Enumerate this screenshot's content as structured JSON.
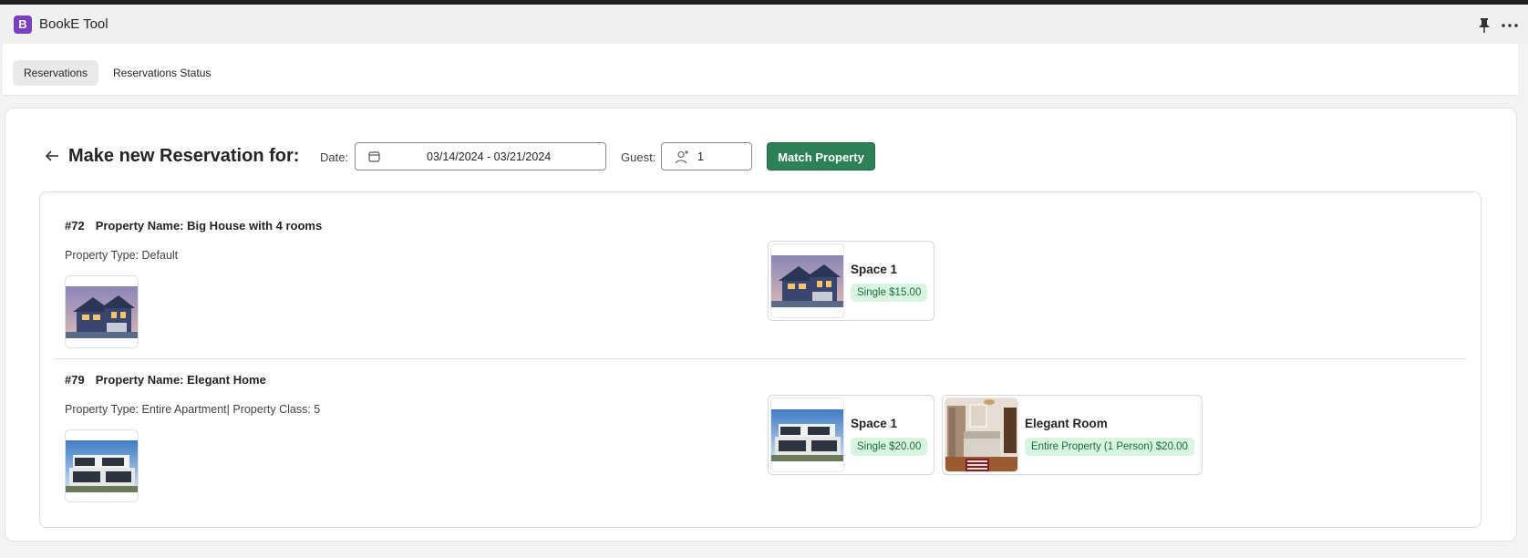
{
  "app": {
    "logo_letter": "B",
    "title": "BookE Tool"
  },
  "header_icons": [
    "pin-icon",
    "more-icon"
  ],
  "tabs": [
    {
      "label": "Reservations",
      "active": true
    },
    {
      "label": "Reservations Status",
      "active": false
    }
  ],
  "form": {
    "heading": "Make new Reservation for:",
    "date_label": "Date:",
    "date_value": "03/14/2024 - 03/21/2024",
    "guest_label": "Guest:",
    "guest_value": "1",
    "match_button": "Match Property"
  },
  "properties": [
    {
      "number": "#72",
      "name": "Property Name: Big House with 4 rooms",
      "type": "Property Type: Default",
      "spaces": [
        {
          "name": "Space 1",
          "price": "Single $15.00"
        }
      ]
    },
    {
      "number": "#79",
      "name": "Property Name: Elegant Home",
      "type": "Property Type: Entire Apartment| Property Class: 5",
      "spaces": [
        {
          "name": "Space 1",
          "price": "Single $20.00"
        },
        {
          "name": "Elegant Room",
          "price": "Entire Property (1 Person) $20.00"
        }
      ]
    }
  ],
  "colors": {
    "brand": "#7b3fc4",
    "primary_button": "#2c8157",
    "price_badge_bg": "#d7f5df",
    "price_badge_text": "#1b6e3a"
  }
}
